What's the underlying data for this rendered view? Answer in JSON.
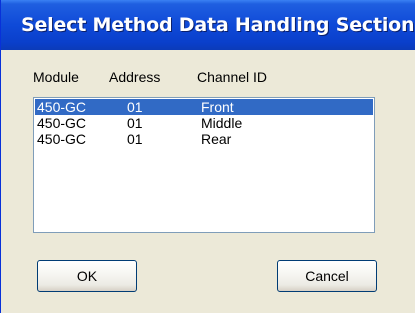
{
  "window": {
    "title": "Select Method Data Handling Section"
  },
  "list": {
    "headers": {
      "module": "Module",
      "address": "Address",
      "channel_id": "Channel ID"
    },
    "rows": [
      {
        "module": "450-GC",
        "address": "01",
        "channel_id": "Front",
        "selected": true
      },
      {
        "module": "450-GC",
        "address": "01",
        "channel_id": "Middle",
        "selected": false
      },
      {
        "module": "450-GC",
        "address": "01",
        "channel_id": "Rear",
        "selected": false
      }
    ]
  },
  "buttons": {
    "ok": "OK",
    "cancel": "Cancel"
  },
  "colors": {
    "selection": "#316AC5",
    "titlebar": "#0A3FCB",
    "dialog_bg": "#ECE9D8"
  }
}
